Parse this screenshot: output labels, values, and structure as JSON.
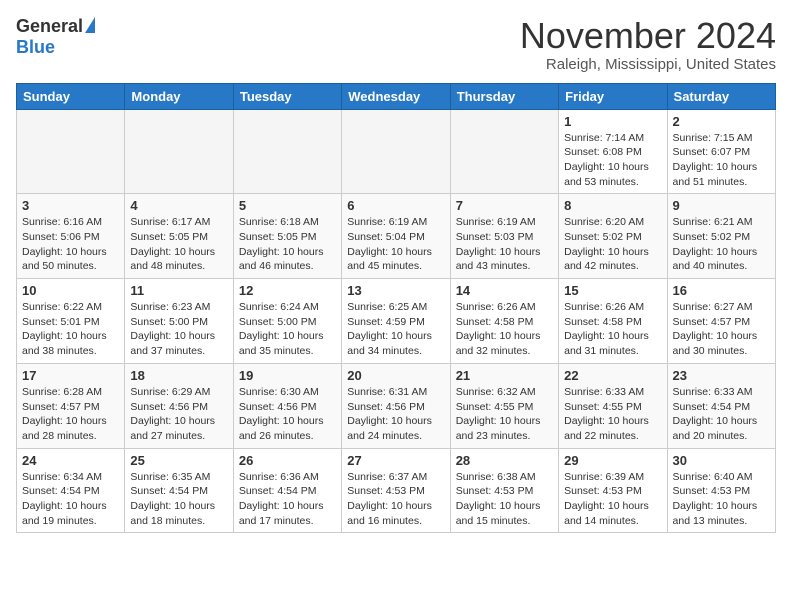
{
  "header": {
    "logo_general": "General",
    "logo_blue": "Blue",
    "month_title": "November 2024",
    "location": "Raleigh, Mississippi, United States"
  },
  "weekdays": [
    "Sunday",
    "Monday",
    "Tuesday",
    "Wednesday",
    "Thursday",
    "Friday",
    "Saturday"
  ],
  "weeks": [
    [
      {
        "day": "",
        "detail": ""
      },
      {
        "day": "",
        "detail": ""
      },
      {
        "day": "",
        "detail": ""
      },
      {
        "day": "",
        "detail": ""
      },
      {
        "day": "",
        "detail": ""
      },
      {
        "day": "1",
        "detail": "Sunrise: 7:14 AM\nSunset: 6:08 PM\nDaylight: 10 hours\nand 53 minutes."
      },
      {
        "day": "2",
        "detail": "Sunrise: 7:15 AM\nSunset: 6:07 PM\nDaylight: 10 hours\nand 51 minutes."
      }
    ],
    [
      {
        "day": "3",
        "detail": "Sunrise: 6:16 AM\nSunset: 5:06 PM\nDaylight: 10 hours\nand 50 minutes."
      },
      {
        "day": "4",
        "detail": "Sunrise: 6:17 AM\nSunset: 5:05 PM\nDaylight: 10 hours\nand 48 minutes."
      },
      {
        "day": "5",
        "detail": "Sunrise: 6:18 AM\nSunset: 5:05 PM\nDaylight: 10 hours\nand 46 minutes."
      },
      {
        "day": "6",
        "detail": "Sunrise: 6:19 AM\nSunset: 5:04 PM\nDaylight: 10 hours\nand 45 minutes."
      },
      {
        "day": "7",
        "detail": "Sunrise: 6:19 AM\nSunset: 5:03 PM\nDaylight: 10 hours\nand 43 minutes."
      },
      {
        "day": "8",
        "detail": "Sunrise: 6:20 AM\nSunset: 5:02 PM\nDaylight: 10 hours\nand 42 minutes."
      },
      {
        "day": "9",
        "detail": "Sunrise: 6:21 AM\nSunset: 5:02 PM\nDaylight: 10 hours\nand 40 minutes."
      }
    ],
    [
      {
        "day": "10",
        "detail": "Sunrise: 6:22 AM\nSunset: 5:01 PM\nDaylight: 10 hours\nand 38 minutes."
      },
      {
        "day": "11",
        "detail": "Sunrise: 6:23 AM\nSunset: 5:00 PM\nDaylight: 10 hours\nand 37 minutes."
      },
      {
        "day": "12",
        "detail": "Sunrise: 6:24 AM\nSunset: 5:00 PM\nDaylight: 10 hours\nand 35 minutes."
      },
      {
        "day": "13",
        "detail": "Sunrise: 6:25 AM\nSunset: 4:59 PM\nDaylight: 10 hours\nand 34 minutes."
      },
      {
        "day": "14",
        "detail": "Sunrise: 6:26 AM\nSunset: 4:58 PM\nDaylight: 10 hours\nand 32 minutes."
      },
      {
        "day": "15",
        "detail": "Sunrise: 6:26 AM\nSunset: 4:58 PM\nDaylight: 10 hours\nand 31 minutes."
      },
      {
        "day": "16",
        "detail": "Sunrise: 6:27 AM\nSunset: 4:57 PM\nDaylight: 10 hours\nand 30 minutes."
      }
    ],
    [
      {
        "day": "17",
        "detail": "Sunrise: 6:28 AM\nSunset: 4:57 PM\nDaylight: 10 hours\nand 28 minutes."
      },
      {
        "day": "18",
        "detail": "Sunrise: 6:29 AM\nSunset: 4:56 PM\nDaylight: 10 hours\nand 27 minutes."
      },
      {
        "day": "19",
        "detail": "Sunrise: 6:30 AM\nSunset: 4:56 PM\nDaylight: 10 hours\nand 26 minutes."
      },
      {
        "day": "20",
        "detail": "Sunrise: 6:31 AM\nSunset: 4:56 PM\nDaylight: 10 hours\nand 24 minutes."
      },
      {
        "day": "21",
        "detail": "Sunrise: 6:32 AM\nSunset: 4:55 PM\nDaylight: 10 hours\nand 23 minutes."
      },
      {
        "day": "22",
        "detail": "Sunrise: 6:33 AM\nSunset: 4:55 PM\nDaylight: 10 hours\nand 22 minutes."
      },
      {
        "day": "23",
        "detail": "Sunrise: 6:33 AM\nSunset: 4:54 PM\nDaylight: 10 hours\nand 20 minutes."
      }
    ],
    [
      {
        "day": "24",
        "detail": "Sunrise: 6:34 AM\nSunset: 4:54 PM\nDaylight: 10 hours\nand 19 minutes."
      },
      {
        "day": "25",
        "detail": "Sunrise: 6:35 AM\nSunset: 4:54 PM\nDaylight: 10 hours\nand 18 minutes."
      },
      {
        "day": "26",
        "detail": "Sunrise: 6:36 AM\nSunset: 4:54 PM\nDaylight: 10 hours\nand 17 minutes."
      },
      {
        "day": "27",
        "detail": "Sunrise: 6:37 AM\nSunset: 4:53 PM\nDaylight: 10 hours\nand 16 minutes."
      },
      {
        "day": "28",
        "detail": "Sunrise: 6:38 AM\nSunset: 4:53 PM\nDaylight: 10 hours\nand 15 minutes."
      },
      {
        "day": "29",
        "detail": "Sunrise: 6:39 AM\nSunset: 4:53 PM\nDaylight: 10 hours\nand 14 minutes."
      },
      {
        "day": "30",
        "detail": "Sunrise: 6:40 AM\nSunset: 4:53 PM\nDaylight: 10 hours\nand 13 minutes."
      }
    ]
  ]
}
